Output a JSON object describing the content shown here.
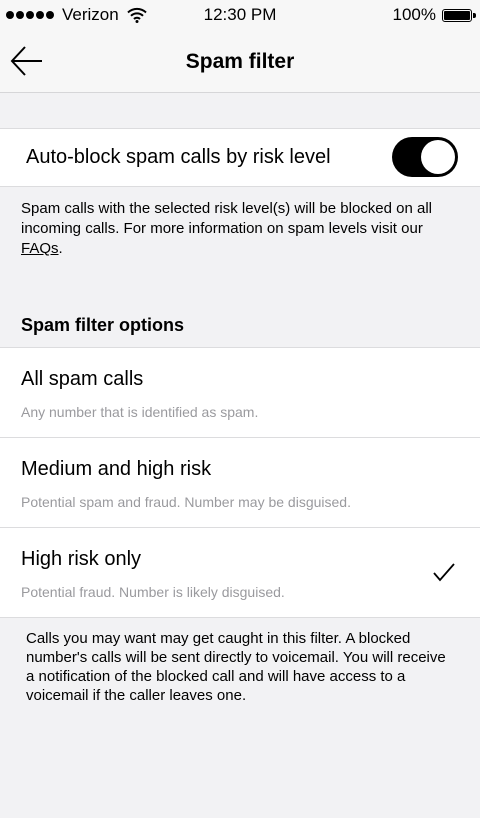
{
  "status_bar": {
    "carrier": "Verizon",
    "time": "12:30 PM",
    "battery": "100%",
    "battery_level": 1.0,
    "icons": [
      "signal-dots-icon",
      "wifi-icon",
      "battery-icon"
    ]
  },
  "nav": {
    "title": "Spam filter",
    "back_icon": "back-arrow-icon"
  },
  "auto_block": {
    "label": "Auto-block spam calls by risk level",
    "enabled": true
  },
  "info": {
    "text": "Spam calls with the selected risk level(s) will be blocked on all incoming calls. For more information on spam levels visit our ",
    "link": "FAQs",
    "suffix": "."
  },
  "section": {
    "title": "Spam filter options"
  },
  "options": [
    {
      "title": "All spam calls",
      "description": "Any number that is identified as spam.",
      "selected": false
    },
    {
      "title": "Medium and high risk",
      "description": "Potential spam and fraud. Number may be disguised.",
      "selected": false
    },
    {
      "title": "High risk only",
      "description": "Potential fraud. Number is likely disguised.",
      "selected": true
    }
  ],
  "footer": {
    "text": "Calls you may want may get caught in this filter. A blocked number's calls will be sent directly to voicemail. You will receive a notification of the blocked call and will have access to a voicemail if the caller leaves one."
  },
  "colors": {
    "background": "#f2f2f4",
    "toggle_on": "#000000",
    "secondary_text": "#9a9a9e"
  }
}
